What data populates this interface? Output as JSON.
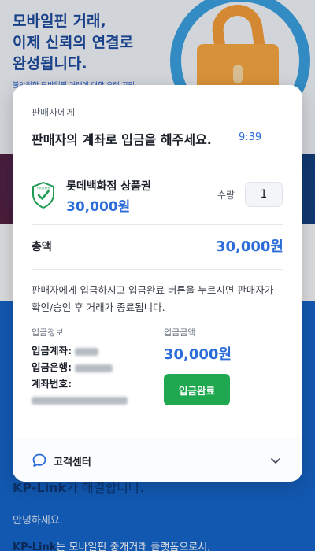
{
  "background": {
    "hero_title": "모바일핀 거래,\n이제 신뢰의 연결로\n완성됩니다.",
    "hero_sub": "불안정한 모바일핀 거래에 대한 오랜 고민",
    "section_title_brand": "KP-Link",
    "section_title_rest": "가 해결합니다.",
    "greeting": "안녕하세요.",
    "desc_brand": "KP-Link",
    "desc_rest": "는 모바일핀 중개거래 플랫폼으로서,"
  },
  "modal": {
    "to_seller": "판매자에게",
    "headline": "판매자의 계좌로 입금을 해주세요.",
    "timer": "9:39",
    "product": {
      "badge_text": "TRUSTED",
      "name": "롯데백화점 상품권",
      "price": "30,000원",
      "quantity_label": "수량",
      "quantity_value": "1"
    },
    "total_label": "총액",
    "total_value": "30,000원",
    "instruction": "판매자에게 입금하시고 입금완료 버튼을 누르시면 판매자가 확인/승인 후 거래가 종료됩니다.",
    "deposit_info_label": "입금정보",
    "account_holder_label": "입금계좌:",
    "bank_label": "입금은행:",
    "account_number_label": "계좌번호:",
    "amount_label": "입금금액",
    "amount_value": "30,000원",
    "pay_button": "입금완료"
  },
  "footer": {
    "label": "고객센터",
    "chat_icon": "chat-bubble-icon",
    "chevron_icon": "chevron-down-icon"
  },
  "colors": {
    "accent_blue": "#2b6cd8",
    "confirm_green": "#1fa84f",
    "page_blue": "#1565c9"
  }
}
